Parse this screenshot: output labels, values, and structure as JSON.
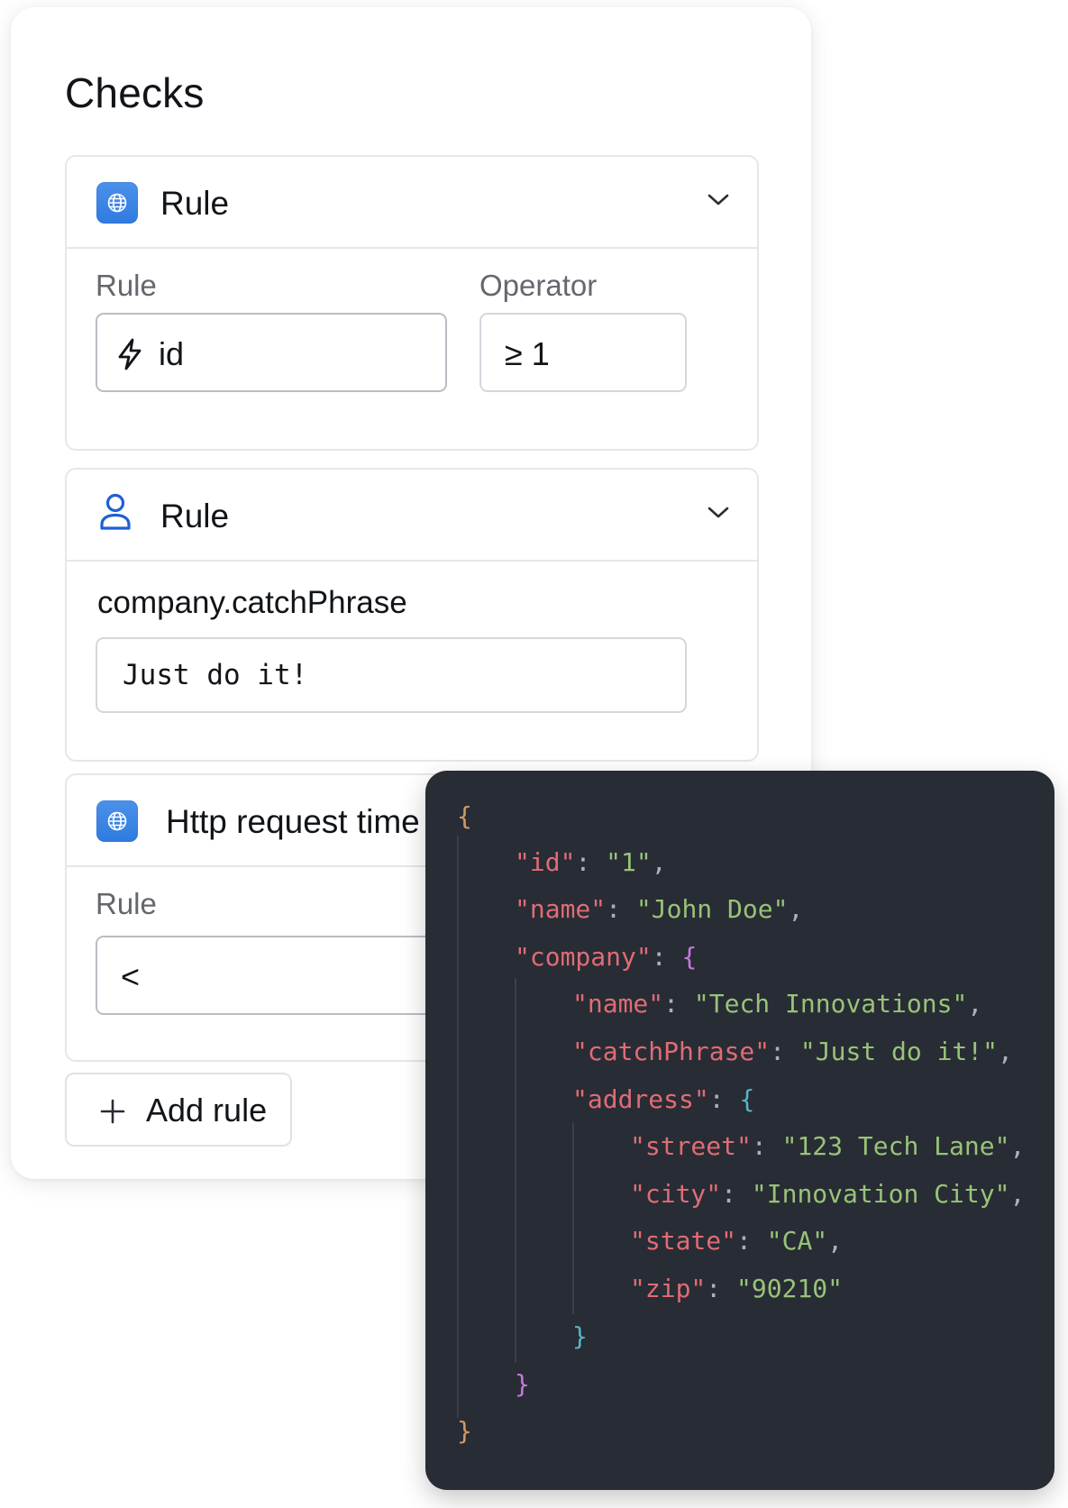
{
  "checks": {
    "title": "Checks",
    "rules": [
      {
        "title": "Rule",
        "icon": "globe-icon",
        "fields": {
          "rule_label": "Rule",
          "rule_value": "id",
          "operator_label": "Operator",
          "operator_value": "≥ 1"
        }
      },
      {
        "title": "Rule",
        "icon": "user-icon",
        "fields": {
          "path_label": "company.catchPhrase",
          "value": "Just do it!"
        }
      },
      {
        "title": "Http request time",
        "icon": "globe-icon",
        "fields": {
          "rule_label": "Rule",
          "rule_value": "<"
        }
      }
    ],
    "add_rule_label": "Add rule"
  },
  "json_preview": {
    "open_brace": "{",
    "close_brace": "}",
    "id": {
      "key": "\"id\"",
      "value": "\"1\""
    },
    "name": {
      "key": "\"name\"",
      "value": "\"John Doe\""
    },
    "company": {
      "key": "\"company\"",
      "name": {
        "key": "\"name\"",
        "value": "\"Tech Innovations\""
      },
      "catchPhrase": {
        "key": "\"catchPhrase\"",
        "value": "\"Just do it!\""
      },
      "address": {
        "key": "\"address\"",
        "street": {
          "key": "\"street\"",
          "value": "\"123 Tech Lane\""
        },
        "city": {
          "key": "\"city\"",
          "value": "\"Innovation City\""
        },
        "state": {
          "key": "\"state\"",
          "value": "\"CA\""
        },
        "zip": {
          "key": "\"zip\"",
          "value": "\"90210\""
        }
      }
    }
  },
  "colors": {
    "accent_blue": "#2f7be0",
    "code_background": "#282c34",
    "json_key": "#e06c75",
    "json_string": "#98c379",
    "brace_level_0": "#d19a66",
    "brace_level_1": "#c678dd",
    "brace_level_2": "#56b6c2"
  }
}
